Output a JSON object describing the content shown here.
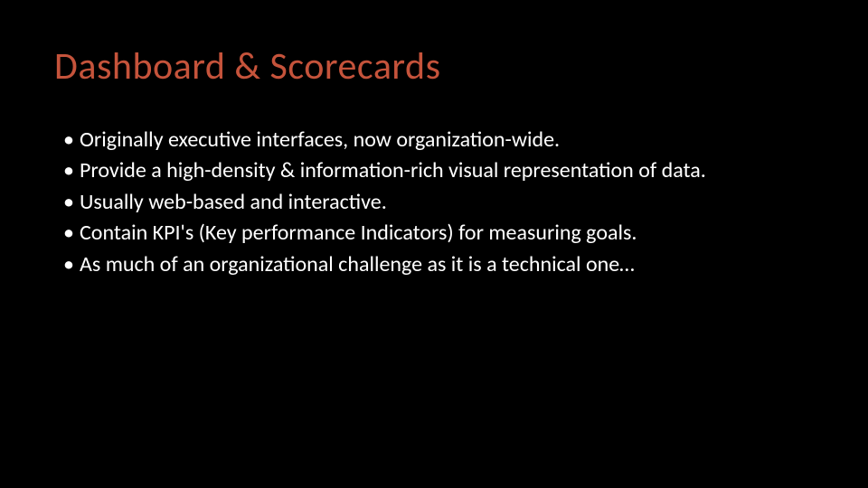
{
  "slide": {
    "title": "Dashboard & Scorecards",
    "bullets": [
      "Originally executive interfaces, now organization-wide.",
      "Provide a high-density & information-rich visual representation of data.",
      "Usually web-based and interactive.",
      "Contain KPI's (Key performance Indicators) for measuring goals.",
      "As much of an organizational challenge as it is a technical one…"
    ]
  }
}
